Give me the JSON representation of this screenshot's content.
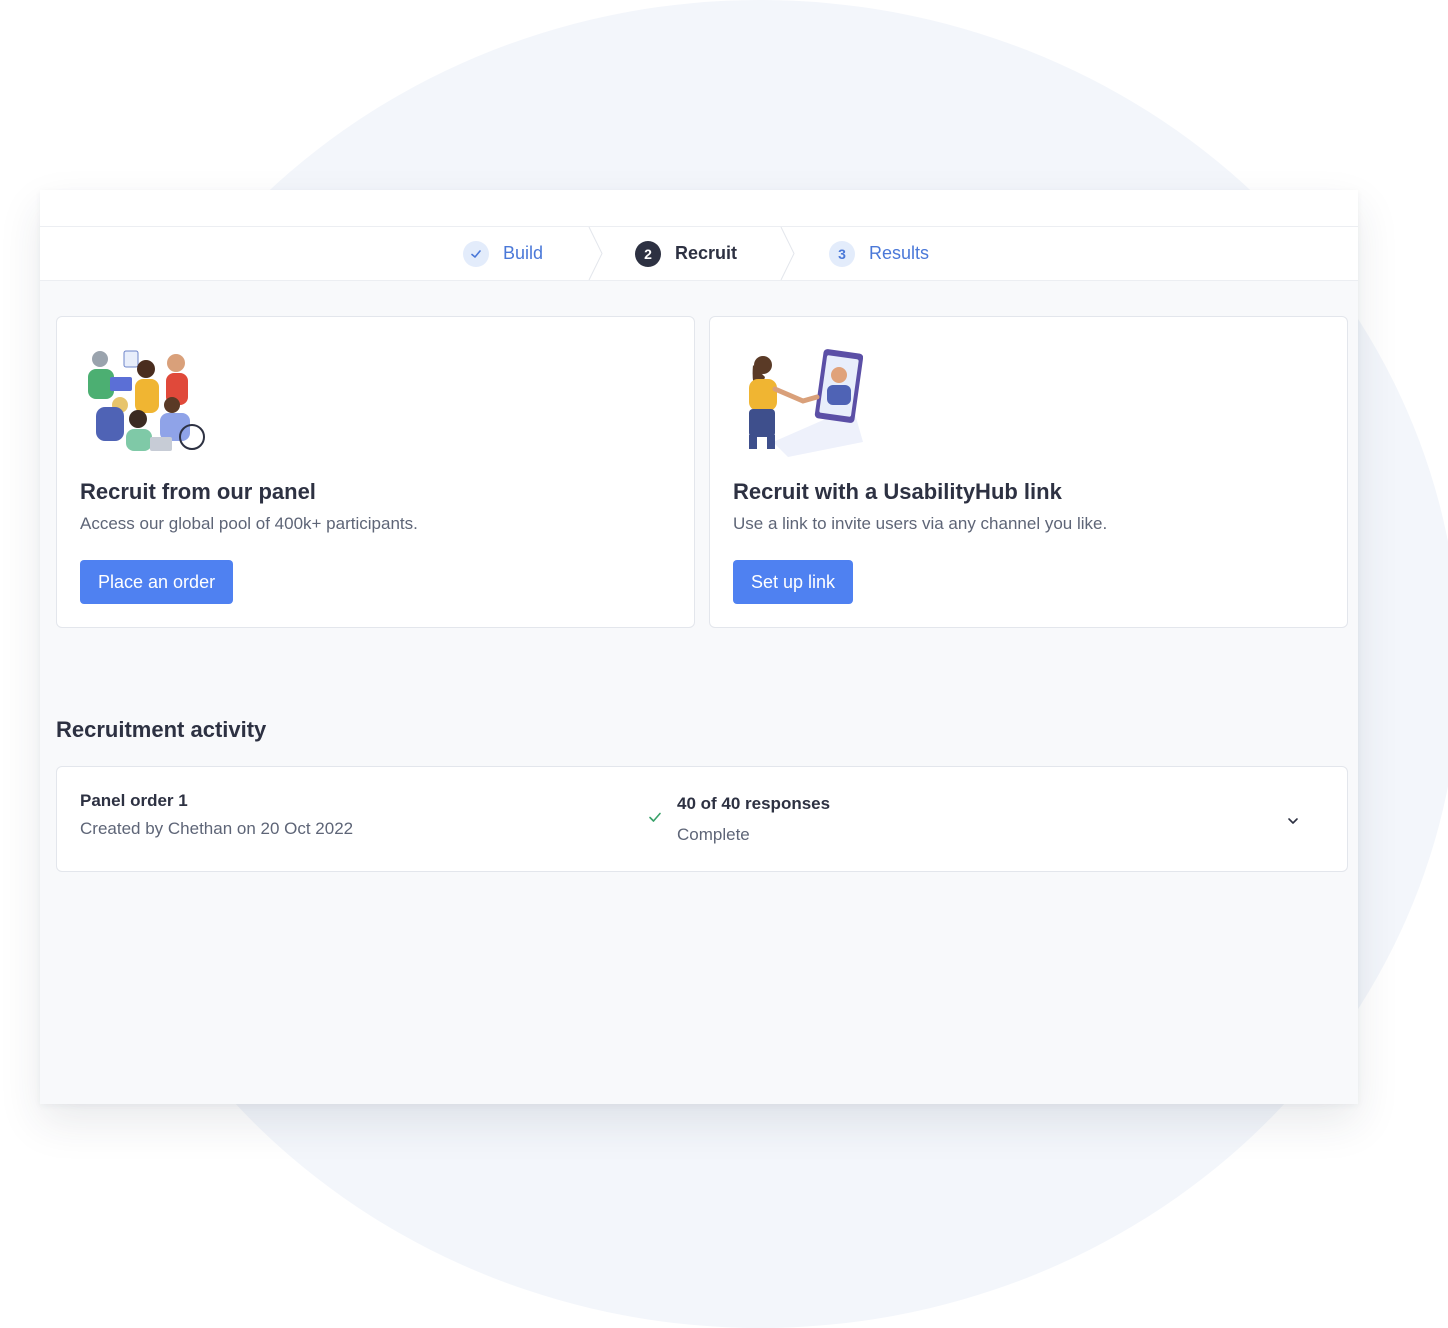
{
  "stepper": {
    "steps": [
      {
        "number": "",
        "label": "Build",
        "state": "done",
        "icon": "check-icon"
      },
      {
        "number": "2",
        "label": "Recruit",
        "state": "active"
      },
      {
        "number": "3",
        "label": "Results",
        "state": "todo"
      }
    ]
  },
  "cards": {
    "panel": {
      "illustration": "diverse-group-illustration",
      "title": "Recruit from our panel",
      "description": "Access our global pool of 400k+ participants.",
      "button_label": "Place an order"
    },
    "link": {
      "illustration": "handshake-illustration",
      "title": "Recruit with a UsabilityHub link",
      "description": "Use a link to invite users via any channel you like.",
      "button_label": "Set up link"
    }
  },
  "activity": {
    "heading": "Recruitment activity",
    "orders": [
      {
        "name": "Panel order 1",
        "meta": "Created by Chethan on 20 Oct 2022",
        "responses": "40 of 40 responses",
        "status": "Complete",
        "status_icon": "check-icon",
        "expand_icon": "chevron-down-icon"
      }
    ]
  },
  "colors": {
    "primary": "#4f81f1",
    "link": "#4a78d8",
    "text_dark": "#2d3142",
    "success": "#38a169"
  }
}
